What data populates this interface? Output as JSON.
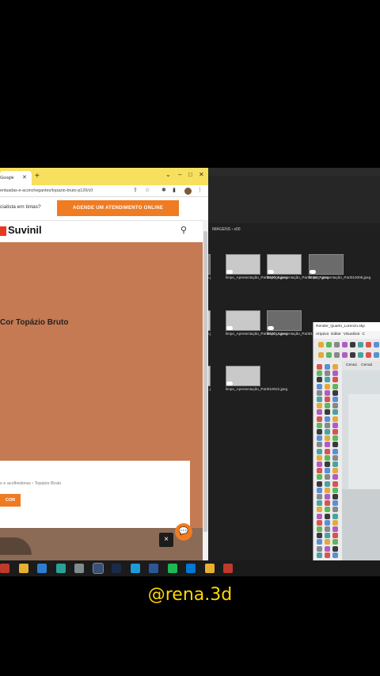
{
  "browser": {
    "tab_title": "Google",
    "new_tab_glyph": "+",
    "url": "entuadas-e-aconchegantes/topazio-bruto-p120/c0",
    "promo_text": "cialista em tintas?",
    "cta_label": "AGENDE UM ATENDIMENTO ONLINE",
    "logo_text": "Suvinil",
    "color_title": "Cor Topázio Bruto",
    "breadcrumb": "s e acolhedoras  ›  Topázio Bruto",
    "card_button": "COR",
    "close_glyph": "×",
    "colors": {
      "tabstrip": "#f6e05e",
      "accent": "#ef7b22",
      "swatch": "#c57a53",
      "logo": "#e8381f"
    }
  },
  "explorer": {
    "path": "IMAGENS  ›  x00",
    "files": [
      {
        "label": "005.j",
        "row": 0,
        "col": 0,
        "partial": true
      },
      {
        "label": "limpo_Apresentação_Part010006.jpeg",
        "row": 0,
        "col": 1
      },
      {
        "label": "limpo_Apresentação_Part010007.jpeg",
        "row": 0,
        "col": 2
      },
      {
        "label": "limpo_Apresentação_Part010008.jpeg",
        "row": 0,
        "col": 3
      },
      {
        "label": "013.j",
        "row": 1,
        "col": 0,
        "partial": true
      },
      {
        "label": "limpo_Apresentação_Part010014.jpeg",
        "row": 1,
        "col": 1
      },
      {
        "label": "limpo_Apresentação_Part010015.jpeg",
        "row": 1,
        "col": 2
      },
      {
        "label": "021.j",
        "row": 2,
        "col": 0,
        "partial": true
      },
      {
        "label": "limpo_Apresentação_Part010022.jpeg",
        "row": 2,
        "col": 1
      }
    ]
  },
  "sketchup": {
    "title": "Render_Quarto_Lorenzo.skp",
    "menu": [
      "Arquivo",
      "Editar",
      "Visualizar",
      "C"
    ],
    "scenes": [
      "Cena1",
      "Cena2"
    ]
  },
  "taskbar": {
    "icons": [
      "app-red-icon",
      "chrome-icon",
      "edge-icon",
      "kanban-icon",
      "app-gray-icon",
      "app-active-icon",
      "photoshop-icon",
      "app-c-icon",
      "word-icon",
      "spotify-icon",
      "mail-icon",
      "chrome-alt-icon",
      "settings-icon"
    ]
  },
  "watermark": "@rena.3d"
}
